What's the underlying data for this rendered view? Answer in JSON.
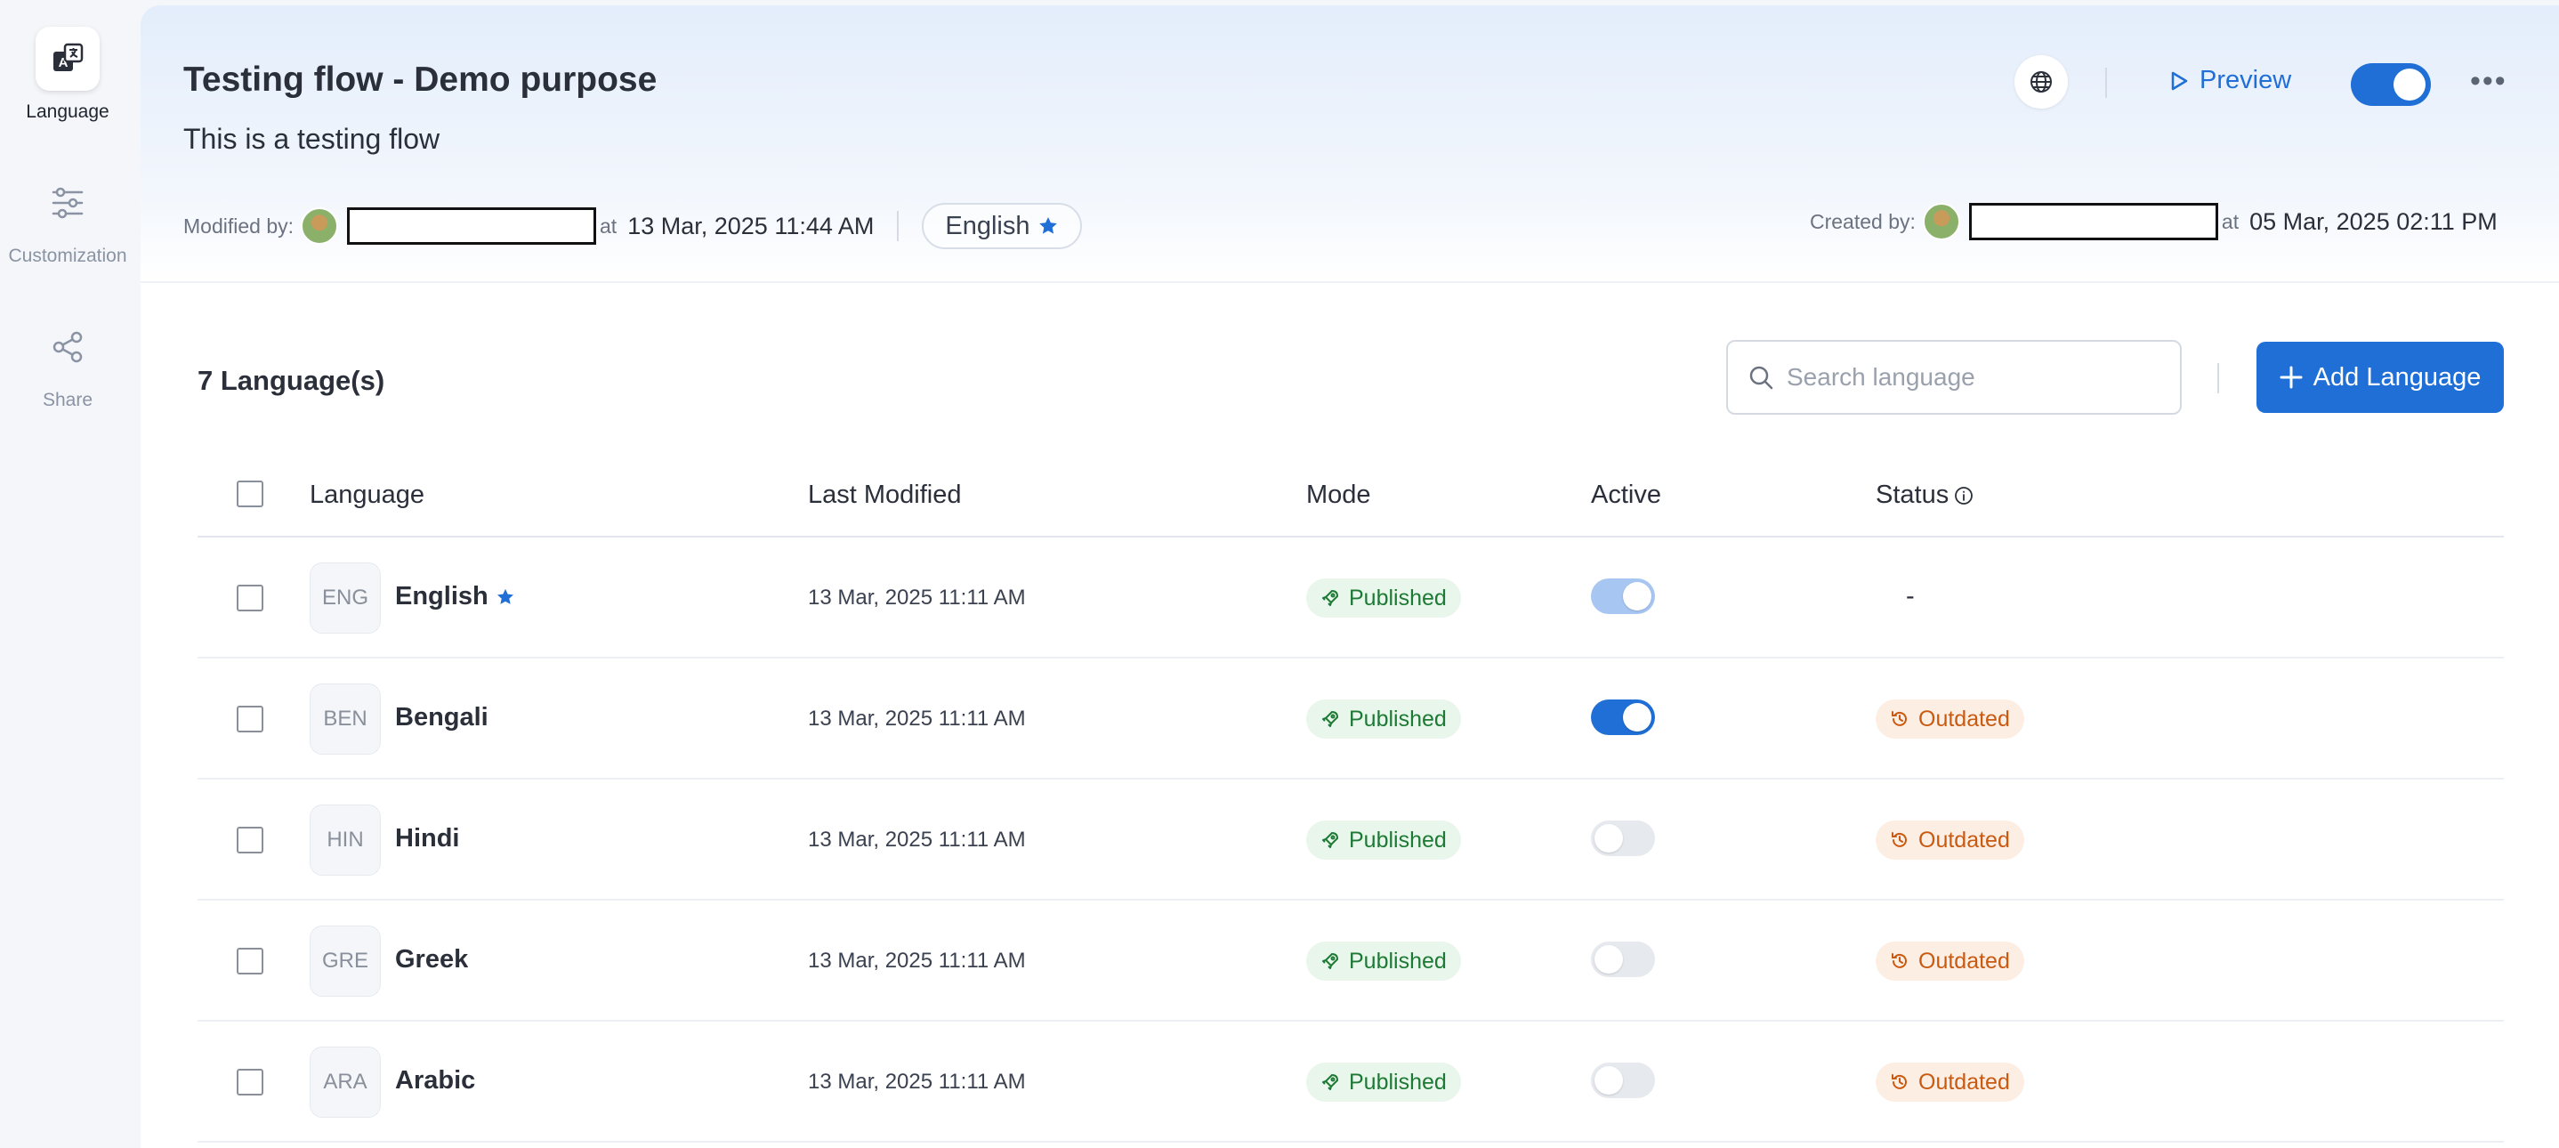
{
  "sidebar": {
    "items": [
      {
        "label": "Language",
        "icon": "language-icon",
        "active": true
      },
      {
        "label": "Customization",
        "icon": "sliders-icon",
        "active": false
      },
      {
        "label": "Share",
        "icon": "share-icon",
        "active": false
      }
    ]
  },
  "header": {
    "title": "Testing flow - Demo purpose",
    "description": "This is a testing flow",
    "modified_by_label": "Modified by:",
    "modified_at_label": "at",
    "modified_datetime": "13 Mar, 2025 11:44 AM",
    "default_language": "English",
    "created_by_label": "Created by:",
    "created_at_label": "at",
    "created_datetime": "05 Mar, 2025 02:11 PM",
    "preview_label": "Preview",
    "flow_active": true
  },
  "toolbar": {
    "count_label": "7 Language(s)",
    "search_placeholder": "Search language",
    "add_label": "Add Language"
  },
  "table": {
    "columns": [
      "Language",
      "Last Modified",
      "Mode",
      "Active",
      "Status"
    ],
    "rows": [
      {
        "code": "ENG",
        "name": "English",
        "default": true,
        "modified": "13 Mar, 2025 11:11 AM",
        "mode": "Published",
        "active": "on-disabled",
        "status": "-"
      },
      {
        "code": "BEN",
        "name": "Bengali",
        "default": false,
        "modified": "13 Mar, 2025 11:11 AM",
        "mode": "Published",
        "active": "on",
        "status": "Outdated"
      },
      {
        "code": "HIN",
        "name": "Hindi",
        "default": false,
        "modified": "13 Mar, 2025 11:11 AM",
        "mode": "Published",
        "active": "off",
        "status": "Outdated"
      },
      {
        "code": "GRE",
        "name": "Greek",
        "default": false,
        "modified": "13 Mar, 2025 11:11 AM",
        "mode": "Published",
        "active": "off",
        "status": "Outdated"
      },
      {
        "code": "ARA",
        "name": "Arabic",
        "default": false,
        "modified": "13 Mar, 2025 11:11 AM",
        "mode": "Published",
        "active": "off",
        "status": "Outdated"
      }
    ]
  },
  "colors": {
    "accent": "#1f6fd6",
    "published_bg": "#e9f6ec",
    "published_text": "#1d7a35",
    "outdated_bg": "#fdeee3",
    "outdated_text": "#c85a12"
  }
}
